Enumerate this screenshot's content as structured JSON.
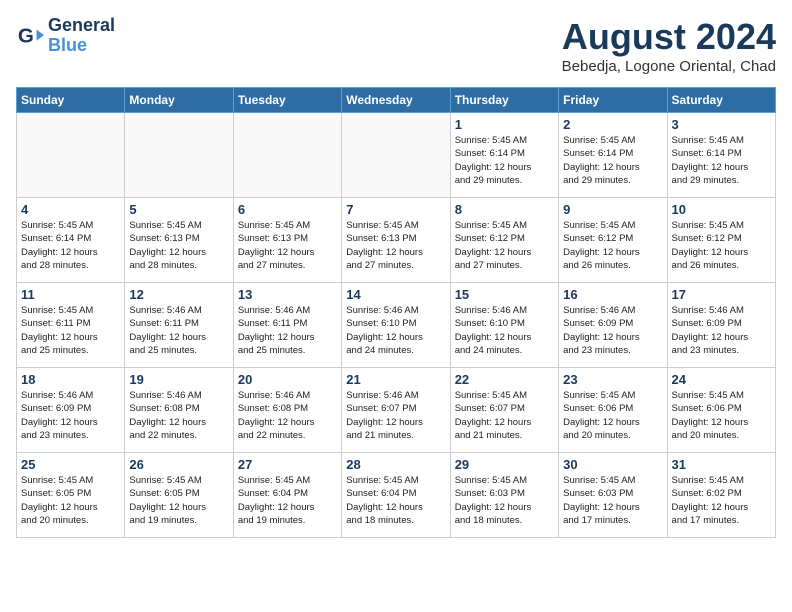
{
  "header": {
    "logo_line1": "General",
    "logo_line2": "Blue",
    "title": "August 2024",
    "subtitle": "Bebedja, Logone Oriental, Chad"
  },
  "days_of_week": [
    "Sunday",
    "Monday",
    "Tuesday",
    "Wednesday",
    "Thursday",
    "Friday",
    "Saturday"
  ],
  "weeks": [
    [
      {
        "day": "",
        "info": ""
      },
      {
        "day": "",
        "info": ""
      },
      {
        "day": "",
        "info": ""
      },
      {
        "day": "",
        "info": ""
      },
      {
        "day": "1",
        "info": "Sunrise: 5:45 AM\nSunset: 6:14 PM\nDaylight: 12 hours\nand 29 minutes."
      },
      {
        "day": "2",
        "info": "Sunrise: 5:45 AM\nSunset: 6:14 PM\nDaylight: 12 hours\nand 29 minutes."
      },
      {
        "day": "3",
        "info": "Sunrise: 5:45 AM\nSunset: 6:14 PM\nDaylight: 12 hours\nand 29 minutes."
      }
    ],
    [
      {
        "day": "4",
        "info": "Sunrise: 5:45 AM\nSunset: 6:14 PM\nDaylight: 12 hours\nand 28 minutes."
      },
      {
        "day": "5",
        "info": "Sunrise: 5:45 AM\nSunset: 6:13 PM\nDaylight: 12 hours\nand 28 minutes."
      },
      {
        "day": "6",
        "info": "Sunrise: 5:45 AM\nSunset: 6:13 PM\nDaylight: 12 hours\nand 27 minutes."
      },
      {
        "day": "7",
        "info": "Sunrise: 5:45 AM\nSunset: 6:13 PM\nDaylight: 12 hours\nand 27 minutes."
      },
      {
        "day": "8",
        "info": "Sunrise: 5:45 AM\nSunset: 6:12 PM\nDaylight: 12 hours\nand 27 minutes."
      },
      {
        "day": "9",
        "info": "Sunrise: 5:45 AM\nSunset: 6:12 PM\nDaylight: 12 hours\nand 26 minutes."
      },
      {
        "day": "10",
        "info": "Sunrise: 5:45 AM\nSunset: 6:12 PM\nDaylight: 12 hours\nand 26 minutes."
      }
    ],
    [
      {
        "day": "11",
        "info": "Sunrise: 5:45 AM\nSunset: 6:11 PM\nDaylight: 12 hours\nand 25 minutes."
      },
      {
        "day": "12",
        "info": "Sunrise: 5:46 AM\nSunset: 6:11 PM\nDaylight: 12 hours\nand 25 minutes."
      },
      {
        "day": "13",
        "info": "Sunrise: 5:46 AM\nSunset: 6:11 PM\nDaylight: 12 hours\nand 25 minutes."
      },
      {
        "day": "14",
        "info": "Sunrise: 5:46 AM\nSunset: 6:10 PM\nDaylight: 12 hours\nand 24 minutes."
      },
      {
        "day": "15",
        "info": "Sunrise: 5:46 AM\nSunset: 6:10 PM\nDaylight: 12 hours\nand 24 minutes."
      },
      {
        "day": "16",
        "info": "Sunrise: 5:46 AM\nSunset: 6:09 PM\nDaylight: 12 hours\nand 23 minutes."
      },
      {
        "day": "17",
        "info": "Sunrise: 5:46 AM\nSunset: 6:09 PM\nDaylight: 12 hours\nand 23 minutes."
      }
    ],
    [
      {
        "day": "18",
        "info": "Sunrise: 5:46 AM\nSunset: 6:09 PM\nDaylight: 12 hours\nand 23 minutes."
      },
      {
        "day": "19",
        "info": "Sunrise: 5:46 AM\nSunset: 6:08 PM\nDaylight: 12 hours\nand 22 minutes."
      },
      {
        "day": "20",
        "info": "Sunrise: 5:46 AM\nSunset: 6:08 PM\nDaylight: 12 hours\nand 22 minutes."
      },
      {
        "day": "21",
        "info": "Sunrise: 5:46 AM\nSunset: 6:07 PM\nDaylight: 12 hours\nand 21 minutes."
      },
      {
        "day": "22",
        "info": "Sunrise: 5:45 AM\nSunset: 6:07 PM\nDaylight: 12 hours\nand 21 minutes."
      },
      {
        "day": "23",
        "info": "Sunrise: 5:45 AM\nSunset: 6:06 PM\nDaylight: 12 hours\nand 20 minutes."
      },
      {
        "day": "24",
        "info": "Sunrise: 5:45 AM\nSunset: 6:06 PM\nDaylight: 12 hours\nand 20 minutes."
      }
    ],
    [
      {
        "day": "25",
        "info": "Sunrise: 5:45 AM\nSunset: 6:05 PM\nDaylight: 12 hours\nand 20 minutes."
      },
      {
        "day": "26",
        "info": "Sunrise: 5:45 AM\nSunset: 6:05 PM\nDaylight: 12 hours\nand 19 minutes."
      },
      {
        "day": "27",
        "info": "Sunrise: 5:45 AM\nSunset: 6:04 PM\nDaylight: 12 hours\nand 19 minutes."
      },
      {
        "day": "28",
        "info": "Sunrise: 5:45 AM\nSunset: 6:04 PM\nDaylight: 12 hours\nand 18 minutes."
      },
      {
        "day": "29",
        "info": "Sunrise: 5:45 AM\nSunset: 6:03 PM\nDaylight: 12 hours\nand 18 minutes."
      },
      {
        "day": "30",
        "info": "Sunrise: 5:45 AM\nSunset: 6:03 PM\nDaylight: 12 hours\nand 17 minutes."
      },
      {
        "day": "31",
        "info": "Sunrise: 5:45 AM\nSunset: 6:02 PM\nDaylight: 12 hours\nand 17 minutes."
      }
    ]
  ]
}
